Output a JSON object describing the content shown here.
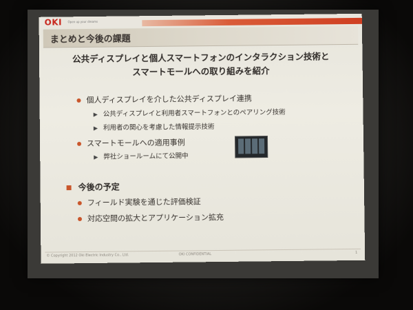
{
  "slide": {
    "logo": "OKI",
    "tagline": "Open up your dreams",
    "title": "まとめと今後の課題",
    "lead_line1": "公共ディスプレイと個人スマートフォンのインタラクション技術と",
    "lead_line2": "スマートモールへの取り組みを紹介",
    "bullets": [
      {
        "text": "個人ディスプレイを介した公共ディスプレイ連携"
      },
      {
        "text": "スマートモールへの適用事例"
      }
    ],
    "sub_bullets": [
      {
        "text": "公共ディスプレイと利用者スマートフォンとのペアリング技術"
      },
      {
        "text": "利用者の関心を考慮した情報提示技術"
      },
      {
        "text": "弊社ショールームにて公開中"
      }
    ],
    "section2": {
      "title": "今後の予定",
      "bullets": [
        {
          "text": "フィールド実験を通じた評価検証"
        },
        {
          "text": "対応空間の拡大とアプリケーション拡充"
        }
      ]
    },
    "footer": {
      "copyright": "© Copyright 2012 Oki Electric Industry Co., Ltd.",
      "confidential": "OKI CONFIDENTIAL",
      "page": "1"
    }
  },
  "colors": {
    "accent": "#c9562b",
    "logo": "#c8281e",
    "background": "#eeece3"
  }
}
